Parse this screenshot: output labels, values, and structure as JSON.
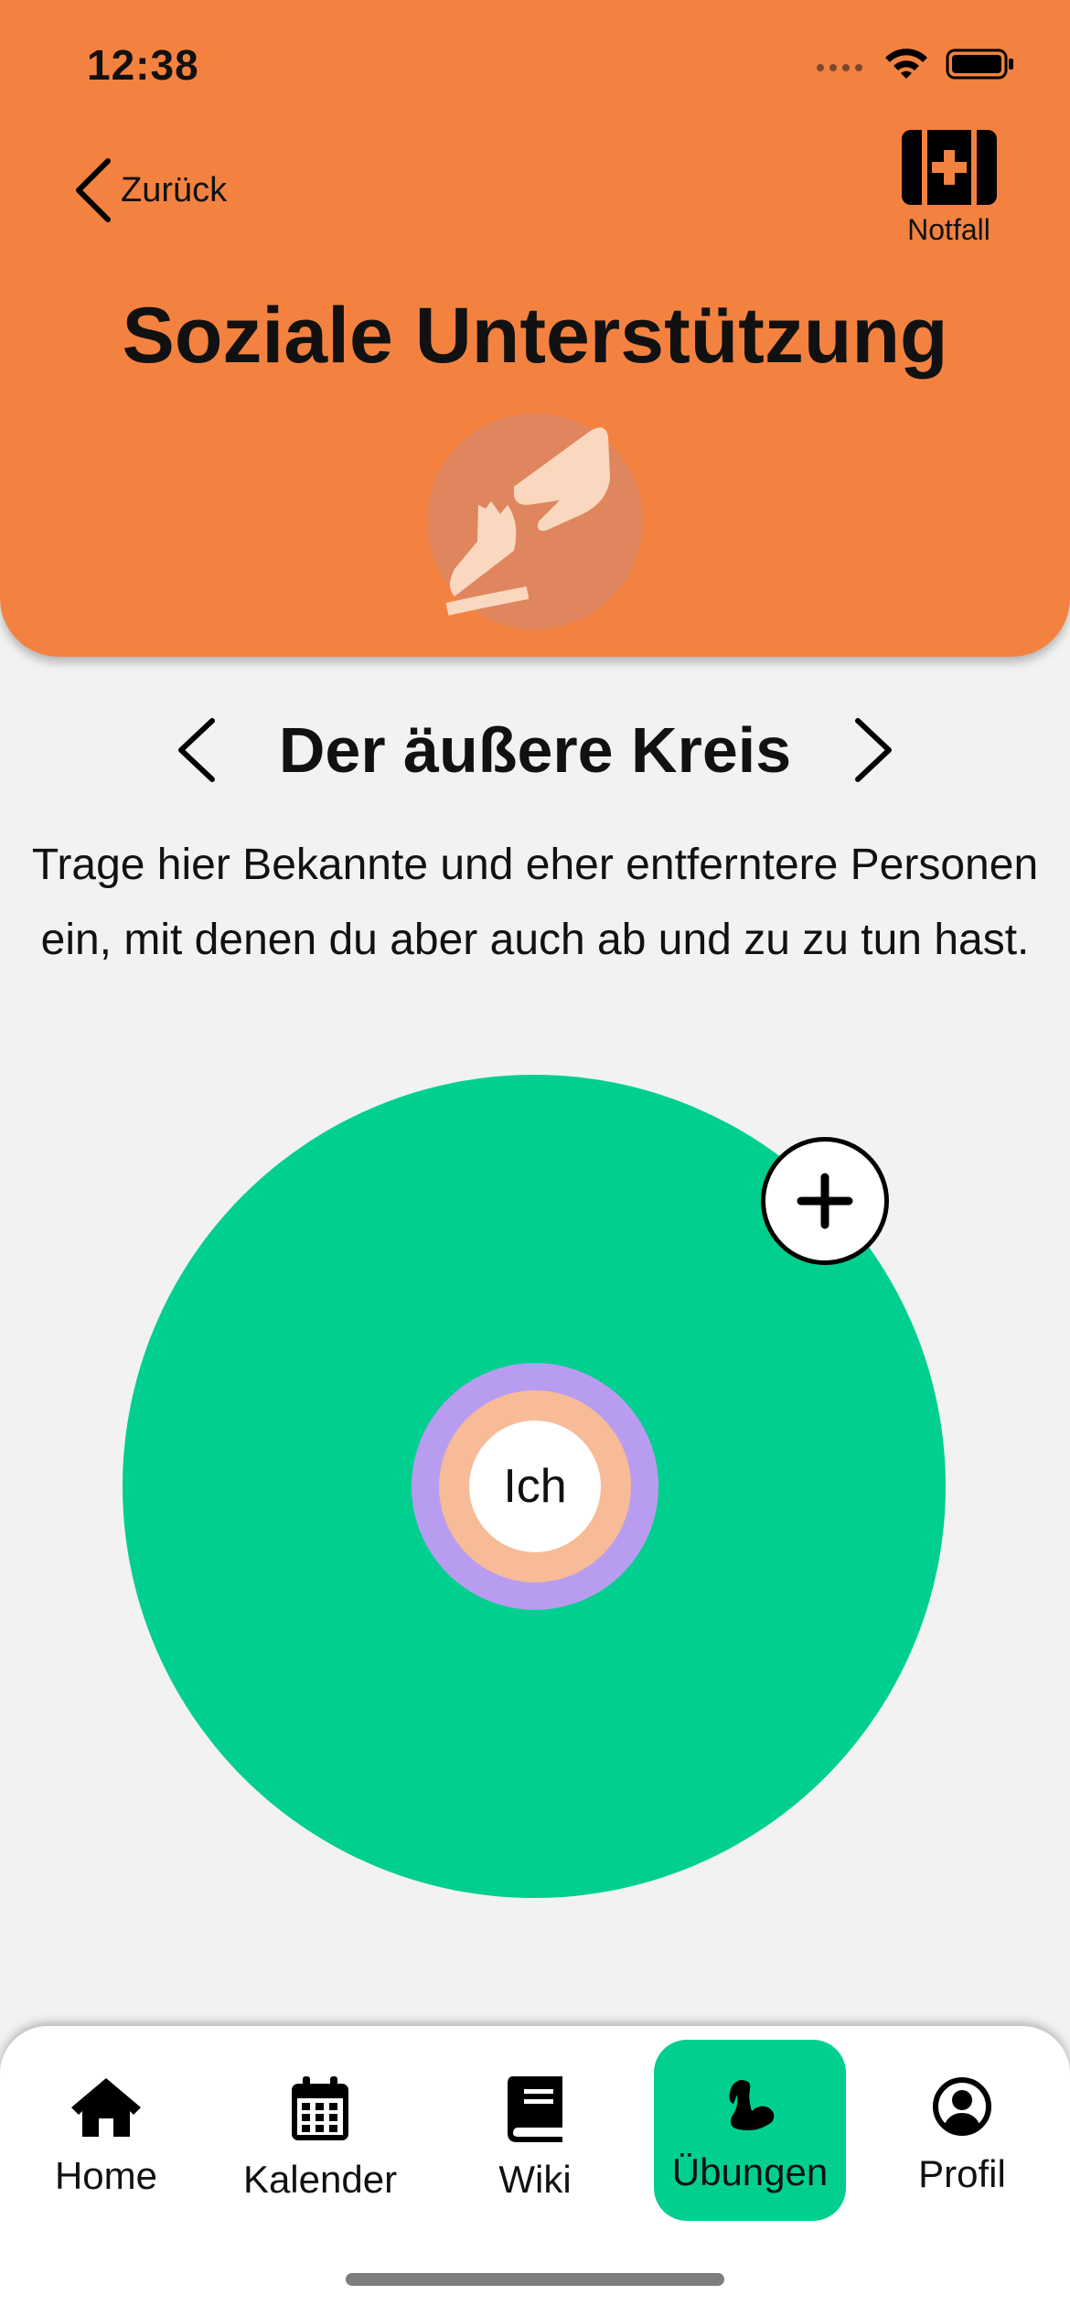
{
  "status_bar": {
    "time": "12:38"
  },
  "header": {
    "back_label": "Zurück",
    "emergency_label": "Notfall",
    "title": "Soziale Unterstützung"
  },
  "section": {
    "title": "Der äußere Kreis",
    "description": "Trage hier Bekannte und eher entferntere Personen ein, mit denen du aber auch ab und zu zu tun hast."
  },
  "circle": {
    "center_label": "Ich",
    "colors": {
      "outer": "#00cf8f",
      "middle": "#b89cf0",
      "inner": "#f7bb98"
    }
  },
  "tabbar": {
    "active": "Übungen",
    "items": [
      {
        "label": "Home",
        "icon": "home-icon"
      },
      {
        "label": "Kalender",
        "icon": "calendar-icon"
      },
      {
        "label": "Wiki",
        "icon": "book-icon"
      },
      {
        "label": "Übungen",
        "icon": "muscle-icon"
      },
      {
        "label": "Profil",
        "icon": "profile-icon"
      }
    ]
  },
  "colors": {
    "header": "#f38240",
    "accent": "#00cf8f",
    "background": "#f2f2f2"
  }
}
